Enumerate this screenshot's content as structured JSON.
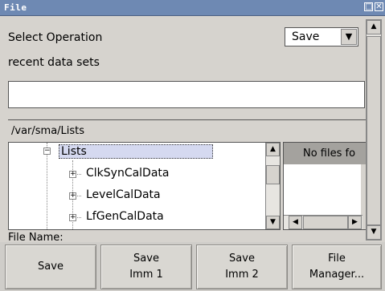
{
  "window": {
    "title": "File",
    "maximize_glyph": "□",
    "close_glyph": "✕"
  },
  "form": {
    "select_operation_label": "Select Operation",
    "operation_value": "Save",
    "recent_label": "recent data sets",
    "recent_value": "",
    "path": "/var/sma/Lists",
    "file_name_label": "File Name:"
  },
  "tree": {
    "root": "Lists",
    "children": [
      "ClkSynCalData",
      "LevelCalData",
      "LfGenCalData"
    ]
  },
  "files_panel": {
    "header": "No files fo"
  },
  "buttons": {
    "save": "Save",
    "save_imm1_line1": "Save",
    "save_imm1_line2": "Imm 1",
    "save_imm2_line1": "Save",
    "save_imm2_line2": "Imm 2",
    "file_manager_line1": "File",
    "file_manager_line2": "Manager..."
  },
  "icons": {
    "dropdown": "chevron-down-icon",
    "scroll_up": "arrow-up-icon",
    "scroll_down": "arrow-down-icon",
    "scroll_left": "arrow-left-icon",
    "scroll_right": "arrow-right-icon",
    "expand": "plus-box-icon",
    "collapse": "minus-box-icon"
  },
  "colors": {
    "titlebar": "#6e89b3",
    "background": "#d6d3ce",
    "selection": "#d5d9f0",
    "files_header": "#a4a29e"
  }
}
